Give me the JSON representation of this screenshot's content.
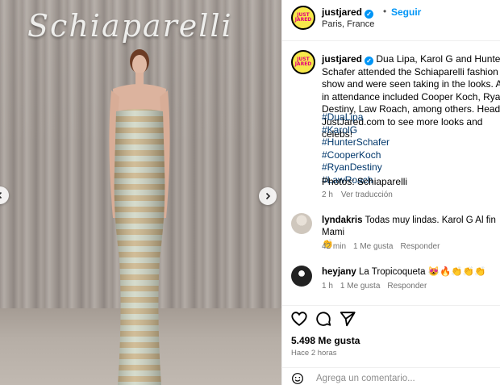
{
  "photo": {
    "logo_text": "Schiaparelli"
  },
  "header": {
    "username": "justjared",
    "follow_label": "Seguir",
    "separator": "•",
    "location": "Paris, France",
    "avatar_line1": "JUST",
    "avatar_line2": "JARED"
  },
  "caption": {
    "username": "justjared",
    "text": "Dua Lipa, Karol G and Hunter Schafer attended the Schiaparelli fashion show and were seen taking in the looks. Also in attendance included Cooper Koch, Ryan Destiny, Law Roach, among others. Head to JustJared.com to see more looks and celebs!",
    "hashtags": [
      "#DuaLipa",
      "#KarolG",
      "#HunterSchafer",
      "#CooperKoch",
      "#RyanDestiny",
      "#LawRoach"
    ],
    "credit": "Photos: Schiaparelli",
    "time": "2 h",
    "translate_label": "Ver traducción"
  },
  "comments": [
    {
      "username": "lyndakris",
      "text": "Todas muy lindas. Karol G Al fin Mami",
      "emoji": "👏",
      "time": "42 min",
      "likes": "1 Me gusta",
      "reply_label": "Responder"
    },
    {
      "username": "heyjany",
      "text": "La Tropicoqueta",
      "emoji": "😻🔥👏👏👏",
      "time": "1 h",
      "likes": "1 Me gusta",
      "reply_label": "Responder"
    }
  ],
  "engagement": {
    "likes": "5.498 Me gusta",
    "time_ago": "Hace 2 horas"
  },
  "add_comment": {
    "placeholder": "Agrega un comentario..."
  },
  "icons": {
    "verified": "verified-badge-icon",
    "like": "heart-icon",
    "comment": "comment-icon",
    "share": "paper-plane-icon",
    "emoji": "smiley-icon",
    "prev": "chevron-left-icon",
    "next": "chevron-right-icon"
  },
  "colors": {
    "accent": "#0095f6",
    "hashtag": "#00376b",
    "muted": "#737373",
    "avatar_bg": "#f7e84b",
    "avatar_text": "#e4007c"
  }
}
